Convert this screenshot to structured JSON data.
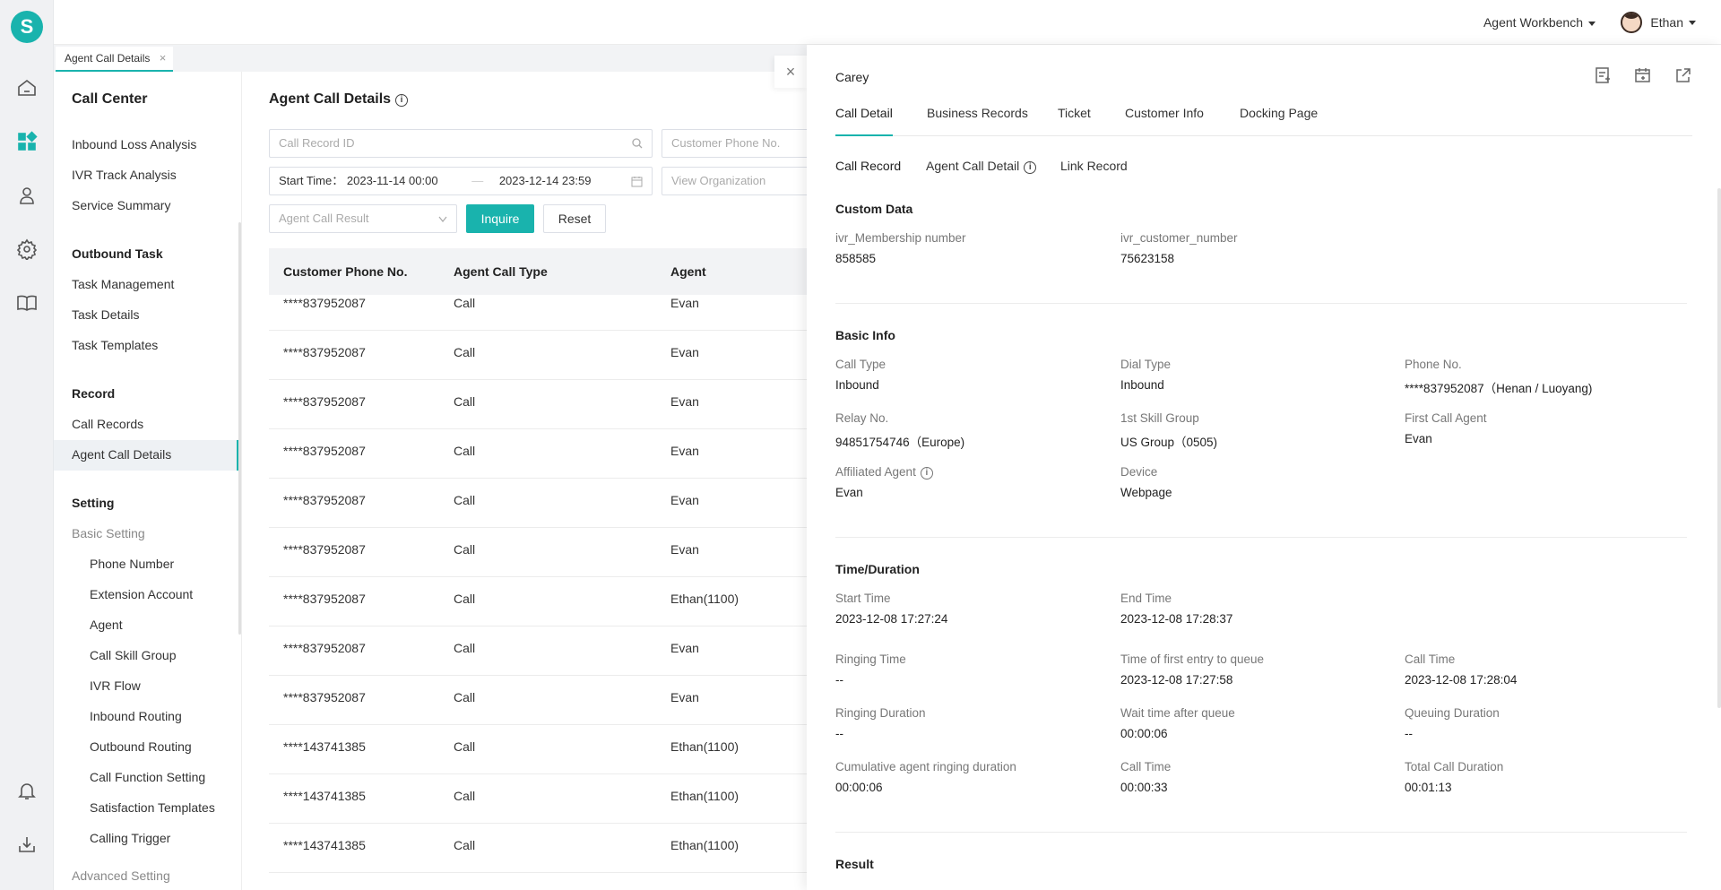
{
  "app": {
    "logo_letter": "S",
    "accent_color": "#19b3ad"
  },
  "rail": {
    "icons": [
      "home-icon",
      "dashboard-icon",
      "agent-icon",
      "settings-icon",
      "book-icon",
      "bell-icon",
      "download-icon"
    ]
  },
  "header": {
    "workbench": "Agent Workbench",
    "user_name": "Ethan"
  },
  "page_tab": {
    "label": "Agent Call Details",
    "close": "×"
  },
  "sidebar": {
    "title": "Call Center",
    "items_top": [
      "Inbound Loss Analysis",
      "IVR Track Analysis",
      "Service Summary"
    ],
    "outbound_head": "Outbound Task",
    "outbound_items": [
      "Task Management",
      "Task Details",
      "Task Templates"
    ],
    "record_head": "Record",
    "record_items": [
      "Call Records",
      "Agent Call Details"
    ],
    "setting_head": "Setting",
    "basic_setting": "Basic Setting",
    "basic_items": [
      "Phone Number",
      "Extension Account",
      "Agent",
      "Call Skill Group",
      "IVR Flow",
      "Inbound Routing",
      "Outbound Routing",
      "Call Function Setting",
      "Satisfaction Templates",
      "Calling Trigger"
    ],
    "advanced_setting": "Advanced Setting"
  },
  "main": {
    "title": "Agent Call Details",
    "call_record_id_placeholder": "Call Record ID",
    "customer_phone_placeholder": "Customer Phone No.",
    "start_time_label": "Start Time：",
    "start_time_from": "2023-11-14 00:00",
    "start_time_to": "2023-12-14 23:59",
    "view_org_placeholder": "View Organization",
    "agent_call_result_placeholder": "Agent Call Result",
    "inquire": "Inquire",
    "reset": "Reset",
    "columns": [
      "Customer Phone No.",
      "Agent Call Type",
      "Agent"
    ],
    "rows": [
      [
        "****837952087",
        "Call",
        "Evan"
      ],
      [
        "****837952087",
        "Call",
        "Evan"
      ],
      [
        "****837952087",
        "Call",
        "Evan"
      ],
      [
        "****837952087",
        "Call",
        "Evan"
      ],
      [
        "****837952087",
        "Call",
        "Evan"
      ],
      [
        "****837952087",
        "Call",
        "Evan"
      ],
      [
        "****837952087",
        "Call",
        "Ethan(1100)"
      ],
      [
        "****837952087",
        "Call",
        "Evan"
      ],
      [
        "****837952087",
        "Call",
        "Evan"
      ],
      [
        "****143741385",
        "Call",
        "Ethan(1100)"
      ],
      [
        "****143741385",
        "Call",
        "Ethan(1100)"
      ],
      [
        "****143741385",
        "Call",
        "Ethan(1100)"
      ]
    ]
  },
  "drawer": {
    "name": "Carey",
    "close": "×",
    "tabs": [
      "Call Detail",
      "Business Records",
      "Ticket",
      "Customer Info",
      "Docking Page"
    ],
    "sub_tabs": [
      "Call Record",
      "Agent Call Detail",
      "Link Record"
    ],
    "custom_data": {
      "title": "Custom Data",
      "f1_label": "ivr_Membership number",
      "f1_value": "858585",
      "f2_label": "ivr_customer_number",
      "f2_value": "75623158"
    },
    "basic_info": {
      "title": "Basic Info",
      "call_type_label": "Call Type",
      "call_type": "Inbound",
      "dial_type_label": "Dial Type",
      "dial_type": "Inbound",
      "phone_label": "Phone No.",
      "phone": "****837952087（Henan / Luoyang)",
      "relay_label": "Relay No.",
      "relay": "94851754746（Europe)",
      "skill_label": "1st Skill Group",
      "skill": "US Group（0505)",
      "first_agent_label": "First Call Agent",
      "first_agent": "Evan",
      "affiliated_label": "Affiliated Agent",
      "affiliated": "Evan",
      "device_label": "Device",
      "device": "Webpage"
    },
    "time": {
      "title": "Time/Duration",
      "start_label": "Start Time",
      "start": "2023-12-08 17:27:24",
      "end_label": "End Time",
      "end": "2023-12-08 17:28:37",
      "ringing_label": "Ringing Time",
      "ringing": "--",
      "queue_entry_label": "Time of first entry to queue",
      "queue_entry": "2023-12-08 17:27:58",
      "call_time_label": "Call Time",
      "call_time": "2023-12-08 17:28:04",
      "ringing_dur_label": "Ringing Duration",
      "ringing_dur": "--",
      "wait_label": "Wait time after queue",
      "wait": "00:00:06",
      "queuing_label": "Queuing Duration",
      "queuing": "--",
      "cum_label": "Cumulative agent ringing duration",
      "cum": "00:00:06",
      "call_time2_label": "Call Time",
      "call_time2": "00:00:33",
      "total_label": "Total Call Duration",
      "total": "00:01:13"
    },
    "result_title": "Result"
  }
}
